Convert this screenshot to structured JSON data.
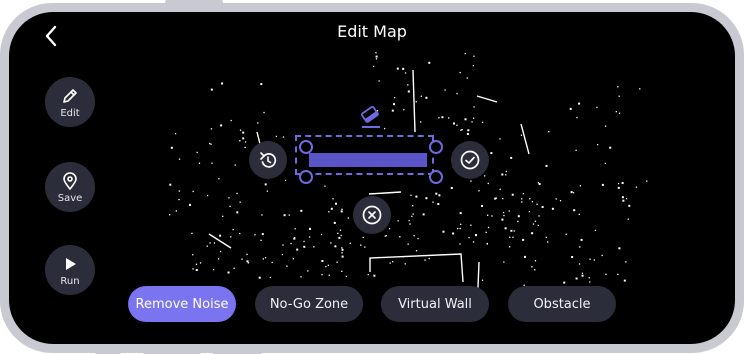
{
  "header": {
    "title": "Edit Map",
    "back_icon": "chevron-left-icon"
  },
  "side_actions": [
    {
      "label": "Edit",
      "icon": "pencil-icon"
    },
    {
      "label": "Save",
      "icon": "location-pin-icon"
    },
    {
      "label": "Run",
      "icon": "play-icon"
    }
  ],
  "selection_controls": {
    "tool_icon": "eraser-icon",
    "undo_icon": "undo-icon",
    "confirm_icon": "check-circle-icon",
    "cancel_icon": "close-circle-icon"
  },
  "tools": [
    {
      "label": "Remove Noise",
      "active": true
    },
    {
      "label": "No-Go Zone",
      "active": false
    },
    {
      "label": "Virtual Wall",
      "active": false
    },
    {
      "label": "Obstacle",
      "active": false
    }
  ],
  "colors": {
    "accent": "#7b74f0",
    "selection": "#6f6ae0",
    "button_bg": "#2c2d3a",
    "screen_bg": "#000000",
    "frame": "#c9c9d2"
  }
}
